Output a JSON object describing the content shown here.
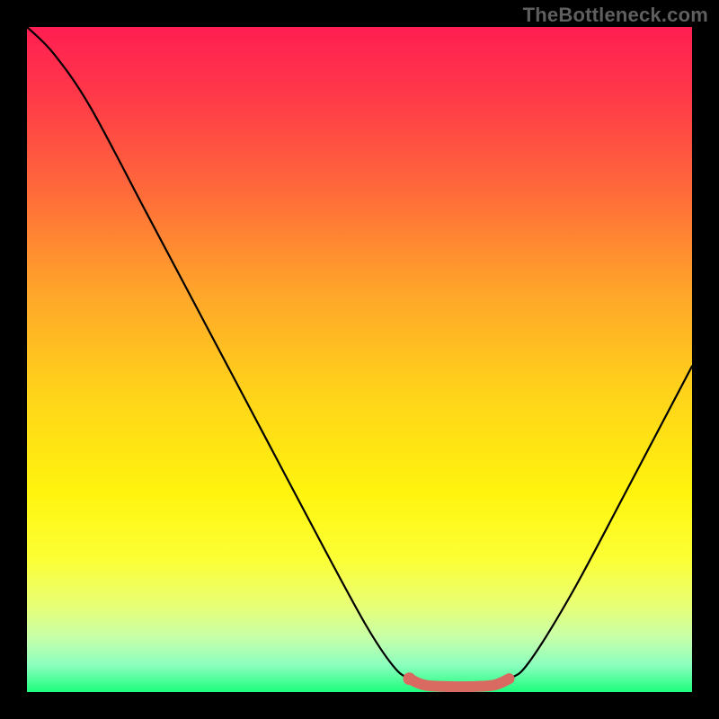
{
  "watermark": "TheBottleneck.com",
  "chart_data": {
    "type": "line",
    "title": "",
    "xlabel": "",
    "ylabel": "",
    "xlim": [
      0,
      100
    ],
    "ylim": [
      0,
      100
    ],
    "gradient_stops": [
      {
        "offset": 0.0,
        "color": "#ff1e52"
      },
      {
        "offset": 0.1,
        "color": "#ff3849"
      },
      {
        "offset": 0.25,
        "color": "#ff6b3a"
      },
      {
        "offset": 0.4,
        "color": "#ffa62a"
      },
      {
        "offset": 0.55,
        "color": "#ffd31a"
      },
      {
        "offset": 0.7,
        "color": "#fff40e"
      },
      {
        "offset": 0.8,
        "color": "#fcff35"
      },
      {
        "offset": 0.87,
        "color": "#e8ff76"
      },
      {
        "offset": 0.92,
        "color": "#c5ffab"
      },
      {
        "offset": 0.96,
        "color": "#8affbe"
      },
      {
        "offset": 1.0,
        "color": "#1dfd7c"
      }
    ],
    "series": [
      {
        "name": "bottleneck-curve",
        "color": "#000000",
        "points": [
          {
            "x": 0.0,
            "y": 100.0
          },
          {
            "x": 4.0,
            "y": 96.0
          },
          {
            "x": 9.5,
            "y": 88.0
          },
          {
            "x": 18.0,
            "y": 72.0
          },
          {
            "x": 27.0,
            "y": 55.0
          },
          {
            "x": 36.0,
            "y": 38.0
          },
          {
            "x": 45.0,
            "y": 21.0
          },
          {
            "x": 51.0,
            "y": 10.0
          },
          {
            "x": 55.0,
            "y": 4.0
          },
          {
            "x": 57.5,
            "y": 2.0
          },
          {
            "x": 62.0,
            "y": 0.5
          },
          {
            "x": 68.0,
            "y": 0.5
          },
          {
            "x": 72.5,
            "y": 2.0
          },
          {
            "x": 75.5,
            "y": 4.5
          },
          {
            "x": 82.0,
            "y": 15.0
          },
          {
            "x": 90.0,
            "y": 30.0
          },
          {
            "x": 100.0,
            "y": 49.0
          }
        ]
      },
      {
        "name": "optimal-zone-marker",
        "color": "#d96a62",
        "points": [
          {
            "x": 57.5,
            "y": 2.0
          },
          {
            "x": 60.0,
            "y": 1.0
          },
          {
            "x": 65.0,
            "y": 0.8
          },
          {
            "x": 70.0,
            "y": 1.0
          },
          {
            "x": 72.5,
            "y": 2.0
          }
        ],
        "start_dot": {
          "x": 57.5,
          "y": 2.0
        }
      }
    ]
  }
}
